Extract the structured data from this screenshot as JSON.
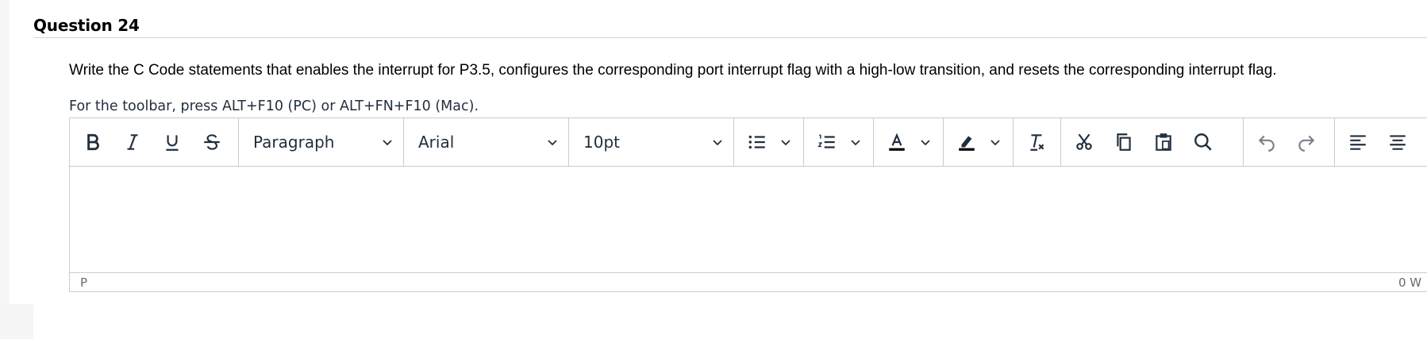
{
  "question": {
    "title": "Question 24",
    "prompt": "Write the C Code statements that enables the interrupt for P3.5, configures the corresponding port interrupt flag with a high-low transition, and resets the corresponding interrupt flag.",
    "toolbar_hint": "For the toolbar, press ALT+F10 (PC) or ALT+FN+F10 (Mac)."
  },
  "editor": {
    "toolbar": {
      "format_buttons": [
        "bold-icon",
        "italic-icon",
        "underline-icon",
        "strikethrough-icon"
      ],
      "block_format": "Paragraph",
      "font_family": "Arial",
      "font_size": "10pt",
      "icons": [
        "bullet-list-icon",
        "numbered-list-icon",
        "text-color-icon",
        "highlight-icon",
        "clear-formatting-icon",
        "cut-icon",
        "copy-icon",
        "paste-icon",
        "find-icon",
        "undo-icon",
        "redo-icon",
        "align-left-icon",
        "align-center-icon"
      ],
      "colors": {
        "icon": "#222f3e",
        "border": "#cccccc"
      }
    },
    "content": "",
    "status": {
      "path": "P",
      "word_count": "0 W"
    }
  }
}
